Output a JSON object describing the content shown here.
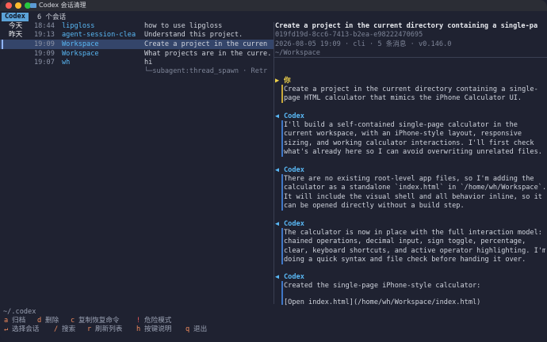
{
  "window": {
    "title": "Codex 会话清理"
  },
  "tabbar": {
    "tab": "Codex",
    "count": "6 个会话"
  },
  "sessions": [
    {
      "group": "今天",
      "time": "18:44",
      "project": "lipgloss",
      "title": "how to use lipgloss"
    },
    {
      "group": "昨天",
      "time": "19:13",
      "project": "agent-session-clea",
      "title": "Understand this project."
    },
    {
      "group": "",
      "time": "19:09",
      "project": "Workspace",
      "title": "Create a project in the curren"
    },
    {
      "group": "",
      "time": "19:09",
      "project": "Workspace",
      "title": "What projects are in the curre."
    },
    {
      "group": "",
      "time": "19:07",
      "project": "wh",
      "title": "hi"
    }
  ],
  "subagent": "└─subagent:thread_spawn · Retr",
  "detail": {
    "title": "Create a project in the current directory containing a single-pa",
    "id": "019fd19d-8cc6-7413-b2ea-e98222470695",
    "meta": "2026-08-05 19:09 · cli · 5 条消息 · v0.146.0",
    "path": "~/Workspace",
    "messages": [
      {
        "marker": "▶",
        "role": "你",
        "lines": [
          "Create a project in the current directory containing a single-",
          "page HTML calculator that mimics the iPhone Calculator UI."
        ]
      },
      {
        "marker": "◀",
        "role": "Codex",
        "lines": [
          "I'll build a self-contained single-page calculator in the",
          "current workspace, with an iPhone-style layout, responsive",
          "sizing, and working calculator interactions. I'll first check",
          "what's already here so I can avoid overwriting unrelated files."
        ]
      },
      {
        "marker": "◀",
        "role": "Codex",
        "lines": [
          "There are no existing root-level app files, so I'm adding the",
          "calculator as a standalone `index.html` in `/home/wh/Workspace`.",
          "It will include the visual shell and all behavior inline, so it",
          "can be opened directly without a build step."
        ]
      },
      {
        "marker": "◀",
        "role": "Codex",
        "lines": [
          "The calculator is now in place with the full interaction model:",
          "chained operations, decimal input, sign toggle, percentage,",
          "clear, keyboard shortcuts, and active operator highlighting. I'm",
          "doing a quick syntax and file check before handing it over."
        ]
      },
      {
        "marker": "◀",
        "role": "Codex",
        "lines": [
          "Created the single-page iPhone-style calculator:",
          "",
          "[Open index.html](/home/wh/Workspace/index.html)"
        ]
      }
    ]
  },
  "footer": {
    "path": "~/.codex",
    "row1": [
      {
        "key": "a",
        "label": "归档"
      },
      {
        "key": "d",
        "label": "删除"
      },
      {
        "key": "c",
        "label": "复制恢复命令"
      },
      {
        "key": "!",
        "label": "危险模式"
      }
    ],
    "row2": [
      {
        "key": "↵",
        "label": "选择会话"
      },
      {
        "key": "/",
        "label": "搜索"
      },
      {
        "key": "r",
        "label": "刷新列表"
      },
      {
        "key": "h",
        "label": "按键说明"
      },
      {
        "key": "q",
        "label": "退出"
      }
    ]
  },
  "colors": {
    "accent": "#5ca3d8",
    "selection": "#34456a",
    "you": "#f0d34b",
    "key": "#f08a5d",
    "danger": "#ef5a5a"
  }
}
